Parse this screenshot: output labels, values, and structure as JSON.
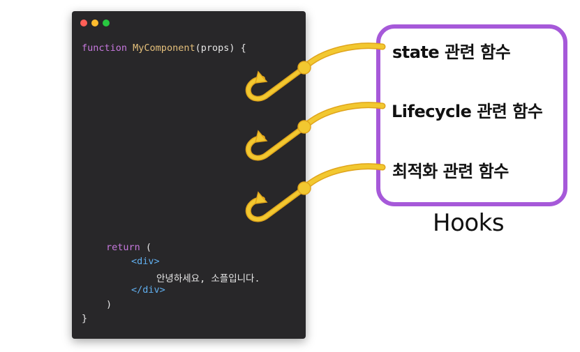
{
  "code": {
    "line1": {
      "kw": "function",
      "fn": "MyComponent",
      "rest": "(props) {"
    },
    "return_kw": "return",
    "return_paren": "(",
    "div_open": "<div>",
    "div_text": "안녕하세요, 소플입니다.",
    "div_close": "</div>",
    "close_paren": ")",
    "close_brace": "}"
  },
  "hooks": {
    "items": [
      {
        "label": "state 관련 함수"
      },
      {
        "label": "Lifecycle 관련 함수"
      },
      {
        "label": "최적화 관련 함수"
      }
    ],
    "title": "Hooks"
  },
  "colors": {
    "code_bg": "#282729",
    "keyword": "#c678dd",
    "function_name": "#e5c07b",
    "tag": "#61afef",
    "hook_yellow": "#f2c830",
    "hook_outline": "#e0a51c",
    "box_border": "#a659d9"
  }
}
